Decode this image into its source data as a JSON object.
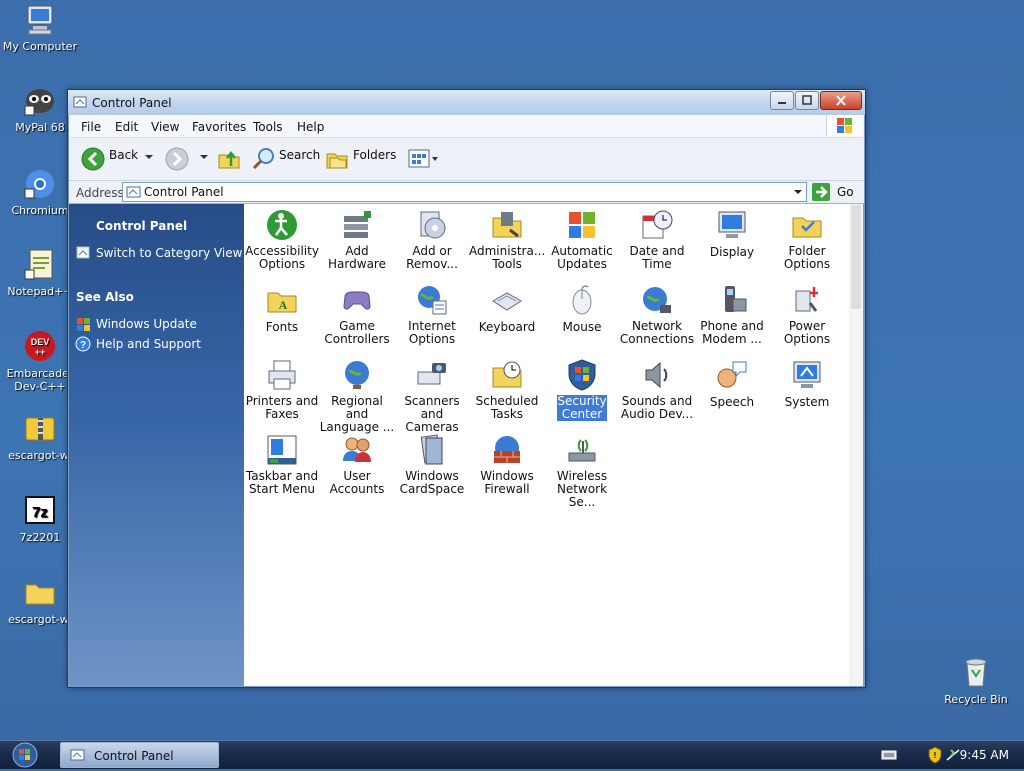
{
  "desktop": {
    "icons": [
      {
        "label": "My Computer",
        "icon": "my-computer-icon"
      },
      {
        "label": "MyPal 68",
        "icon": "mypal-icon"
      },
      {
        "label": "Chromium",
        "icon": "chromium-icon"
      },
      {
        "label": "Notepad++",
        "icon": "notepad-plus-icon"
      },
      {
        "label": "Embarcader\nDev-C++",
        "icon": "devcpp-icon"
      },
      {
        "label": "escargot-wl",
        "icon": "zip-folder-icon"
      },
      {
        "label": "7z2201",
        "icon": "7zip-icon"
      },
      {
        "label": "escargot-wl",
        "icon": "folder-icon"
      },
      {
        "label": "Recycle Bin",
        "icon": "recycle-bin-icon"
      }
    ]
  },
  "window": {
    "title": "Control Panel",
    "menu": [
      "File",
      "Edit",
      "View",
      "Favorites",
      "Tools",
      "Help"
    ],
    "toolbar": {
      "back": "Back",
      "search": "Search",
      "folders": "Folders"
    },
    "address": {
      "label": "Address",
      "value": "Control Panel",
      "go": "Go"
    },
    "pane": {
      "title": "Control Panel",
      "switch_view": "Switch to Category View",
      "see_also": "See Also",
      "links": [
        "Windows Update",
        "Help and Support"
      ]
    },
    "items": [
      {
        "label": "Accessibility\nOptions",
        "icon": "accessibility-icon"
      },
      {
        "label": "Add\nHardware",
        "icon": "add-hardware-icon"
      },
      {
        "label": "Add or\nRemov...",
        "icon": "add-remove-programs-icon"
      },
      {
        "label": "Administra...\nTools",
        "icon": "administrative-tools-icon"
      },
      {
        "label": "Automatic\nUpdates",
        "icon": "automatic-updates-icon"
      },
      {
        "label": "Date and\nTime",
        "icon": "date-time-icon"
      },
      {
        "label": "Display",
        "icon": "display-icon"
      },
      {
        "label": "Folder\nOptions",
        "icon": "folder-options-icon"
      },
      {
        "label": "Fonts",
        "icon": "fonts-icon"
      },
      {
        "label": "Game\nControllers",
        "icon": "game-controllers-icon"
      },
      {
        "label": "Internet\nOptions",
        "icon": "internet-options-icon"
      },
      {
        "label": "Keyboard",
        "icon": "keyboard-icon"
      },
      {
        "label": "Mouse",
        "icon": "mouse-icon"
      },
      {
        "label": "Network\nConnections",
        "icon": "network-connections-icon"
      },
      {
        "label": "Phone and\nModem ...",
        "icon": "phone-modem-icon"
      },
      {
        "label": "Power\nOptions",
        "icon": "power-options-icon"
      },
      {
        "label": "Printers and\nFaxes",
        "icon": "printers-faxes-icon"
      },
      {
        "label": "Regional and\nLanguage ...",
        "icon": "regional-language-icon"
      },
      {
        "label": "Scanners and\nCameras",
        "icon": "scanners-cameras-icon"
      },
      {
        "label": "Scheduled\nTasks",
        "icon": "scheduled-tasks-icon"
      },
      {
        "label": "Security\nCenter",
        "icon": "security-center-icon",
        "selected": true
      },
      {
        "label": "Sounds and\nAudio Dev...",
        "icon": "sounds-audio-icon"
      },
      {
        "label": "Speech",
        "icon": "speech-icon"
      },
      {
        "label": "System",
        "icon": "system-icon"
      },
      {
        "label": "Taskbar and\nStart Menu",
        "icon": "taskbar-start-menu-icon"
      },
      {
        "label": "User\nAccounts",
        "icon": "user-accounts-icon"
      },
      {
        "label": "Windows\nCardSpace",
        "icon": "cardspace-icon"
      },
      {
        "label": "Windows\nFirewall",
        "icon": "firewall-icon"
      },
      {
        "label": "Wireless\nNetwork Se...",
        "icon": "wireless-network-icon"
      }
    ]
  },
  "taskbar": {
    "button": "Control Panel",
    "clock": "9:45 AM"
  },
  "colors": {
    "desktop": "#3b6eab",
    "pane": "#3766a7",
    "selection": "#3d7bd6"
  }
}
